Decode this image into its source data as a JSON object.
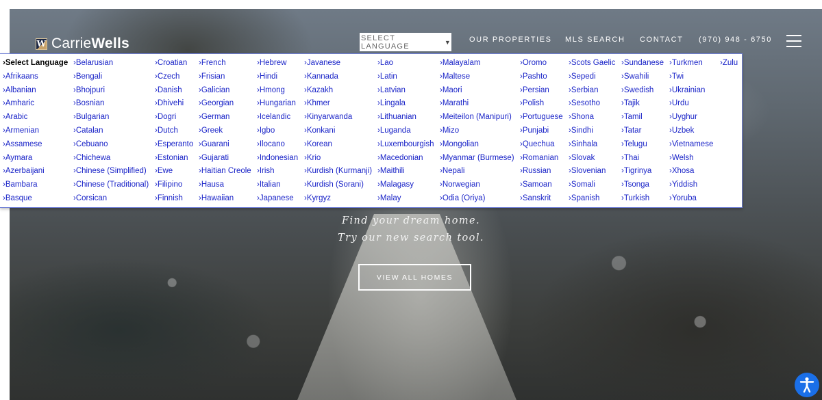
{
  "header": {
    "logo": {
      "icon": "carriewells-logo-mark",
      "mark_letter": "W",
      "name_light": "Carrie",
      "name_bold": "Wells"
    },
    "language_select": {
      "label": "SELECT LANGUAGE",
      "caret": "▼"
    },
    "nav": [
      {
        "label": "OUR PROPERTIES"
      },
      {
        "label": "MLS SEARCH"
      },
      {
        "label": "CONTACT"
      },
      {
        "label": "(970) 948 - 6750"
      }
    ],
    "menu_icon": "hamburger-icon"
  },
  "language_menu": {
    "prefix": "›",
    "selected": "Select Language",
    "columns": [
      [
        "Select Language",
        "Afrikaans",
        "Albanian",
        "Amharic",
        "Arabic",
        "Armenian",
        "Assamese",
        "Aymara",
        "Azerbaijani",
        "Bambara",
        "Basque"
      ],
      [
        "Belarusian",
        "Bengali",
        "Bhojpuri",
        "Bosnian",
        "Bulgarian",
        "Catalan",
        "Cebuano",
        "Chichewa",
        "Chinese (Simplified)",
        "Chinese (Traditional)",
        "Corsican"
      ],
      [
        "Croatian",
        "Czech",
        "Danish",
        "Dhivehi",
        "Dogri",
        "Dutch",
        "Esperanto",
        "Estonian",
        "Ewe",
        "Filipino",
        "Finnish"
      ],
      [
        "French",
        "Frisian",
        "Galician",
        "Georgian",
        "German",
        "Greek",
        "Guarani",
        "Gujarati",
        "Haitian Creole",
        "Hausa",
        "Hawaiian"
      ],
      [
        "Hebrew",
        "Hindi",
        "Hmong",
        "Hungarian",
        "Icelandic",
        "Igbo",
        "Ilocano",
        "Indonesian",
        "Irish",
        "Italian",
        "Japanese"
      ],
      [
        "Javanese",
        "Kannada",
        "Kazakh",
        "Khmer",
        "Kinyarwanda",
        "Konkani",
        "Korean",
        "Krio",
        "Kurdish (Kurmanji)",
        "Kurdish (Sorani)",
        "Kyrgyz"
      ],
      [
        "Lao",
        "Latin",
        "Latvian",
        "Lingala",
        "Lithuanian",
        "Luganda",
        "Luxembourgish",
        "Macedonian",
        "Maithili",
        "Malagasy",
        "Malay"
      ],
      [
        "Malayalam",
        "Maltese",
        "Maori",
        "Marathi",
        "Meiteilon (Manipuri)",
        "Mizo",
        "Mongolian",
        "Myanmar (Burmese)",
        "Nepali",
        "Norwegian",
        "Odia (Oriya)"
      ],
      [
        "Oromo",
        "Pashto",
        "Persian",
        "Polish",
        "Portuguese",
        "Punjabi",
        "Quechua",
        "Romanian",
        "Russian",
        "Samoan",
        "Sanskrit"
      ],
      [
        "Scots Gaelic",
        "Sepedi",
        "Serbian",
        "Sesotho",
        "Shona",
        "Sindhi",
        "Sinhala",
        "Slovak",
        "Slovenian",
        "Somali",
        "Spanish"
      ],
      [
        "Sundanese",
        "Swahili",
        "Swedish",
        "Tajik",
        "Tamil",
        "Tatar",
        "Telugu",
        "Thai",
        "Tigrinya",
        "Tsonga",
        "Turkish"
      ],
      [
        "Turkmen",
        "Twi",
        "Ukrainian",
        "Urdu",
        "Uyghur",
        "Uzbek",
        "Vietnamese",
        "Welsh",
        "Xhosa",
        "Yiddish",
        "Yoruba"
      ],
      [
        "Zulu"
      ]
    ]
  },
  "hero": {
    "tagline_line1": "Find your dream home.",
    "tagline_line2": "Try our new search tool.",
    "cta_label": "VIEW ALL HOMES"
  },
  "accessibility": {
    "icon": "accessibility-icon",
    "color": "#1a6fe8"
  },
  "colors": {
    "link": "#1a24c8",
    "panel_border": "#6f7fd6"
  }
}
